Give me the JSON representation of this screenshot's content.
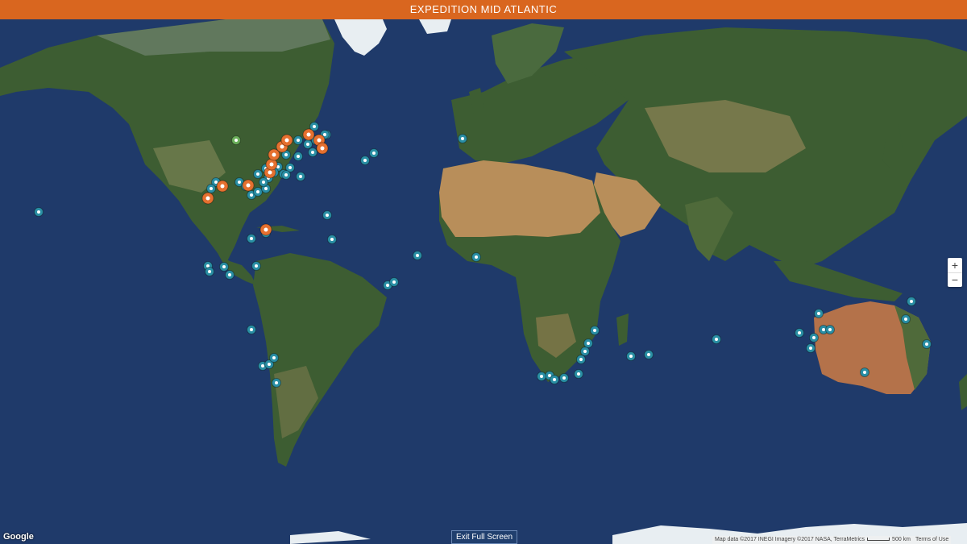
{
  "header": {
    "title": "EXPEDITION MID ATLANTIC"
  },
  "map": {
    "zoom_in": "+",
    "zoom_out": "−",
    "exit_label": "Exit Full Screen",
    "google_label": "Google",
    "attribution": "Map data ©2017 INEGI Imagery ©2017 NASA, TerraMetrics",
    "scale_label": "500 km",
    "terms_label": "Terms of Use",
    "colors": {
      "ocean": "#1f3a6a",
      "land": "#3d5d32",
      "desert": "#b88e5a",
      "ice": "#e8eef2",
      "marker_teal": "#2a8fa5",
      "marker_orange": "#e5702f",
      "marker_green": "#6bae5a"
    },
    "marker_groups": [
      {
        "type": "teal",
        "label": "site-marker"
      },
      {
        "type": "orange",
        "label": "expedition-marker"
      },
      {
        "type": "green",
        "label": "inland-marker"
      }
    ]
  }
}
